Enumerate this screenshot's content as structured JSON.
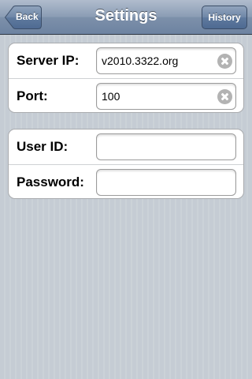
{
  "nav": {
    "title": "Settings",
    "back_label": "Back",
    "history_label": "History"
  },
  "server_group": {
    "server_ip": {
      "label": "Server IP:",
      "value": "v2010.3322.org",
      "icon": "clear-icon"
    },
    "port": {
      "label": "Port:",
      "value": "100",
      "icon": "clear-icon"
    }
  },
  "login_group": {
    "user_id": {
      "label": "User ID:",
      "value": ""
    },
    "password": {
      "label": "Password:",
      "value": ""
    }
  },
  "colors": {
    "nav_bar": "#7d90aa",
    "background": "#c5ccd4",
    "group_background": "#ffffff"
  }
}
